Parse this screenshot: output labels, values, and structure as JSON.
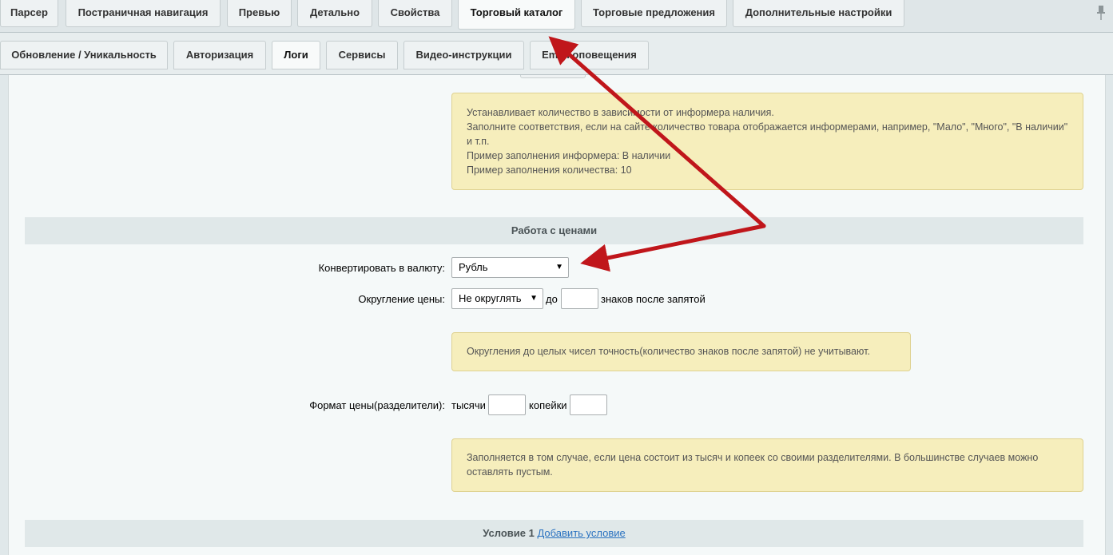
{
  "tabs_top": [
    "Парсер",
    "Постраничная навигация",
    "Превью",
    "Детально",
    "Свойства",
    "Торговый каталог",
    "Торговые предложения",
    "Дополнительные настройки"
  ],
  "tabs_second": [
    "Обновление / Уникальность",
    "Авторизация",
    "Логи",
    "Сервисы",
    "Видео-инструкции",
    "Email оповещения"
  ],
  "info_quantity": {
    "line1": "Устанавливает количество в зависимости от информера наличия.",
    "line2": "Заполните соответствия, если на сайте количество товара отображается информерами, например, \"Мало\", \"Много\", \"В наличии\" и т.п.",
    "line3": "Пример заполнения информера: В наличии",
    "line4": "Пример заполнения количества: 10"
  },
  "section_prices": "Работа с ценами",
  "convert": {
    "label": "Конвертировать в валюту:",
    "value": "Рубль"
  },
  "rounding": {
    "label": "Округление цены:",
    "value": "Не округлять",
    "to": "до",
    "suffix": "знаков после запятой"
  },
  "info_rounding": "Округления до целых чисел точность(количество знаков после запятой) не учитывают.",
  "format": {
    "label": "Формат цены(разделители):",
    "thousands": "тысячи",
    "kopecks": "копейки"
  },
  "info_format": "Заполняется в том случае, если цена состоит из тысяч и копеек со своими разделителями. В большинстве случаев можно оставлять пустым.",
  "condition": {
    "title": "Условие 1",
    "link": "Добавить условие"
  },
  "colors": {
    "annotation_arrow": "#c0161b",
    "note_bg": "#f6eebc",
    "section_bg": "#e0e8e9",
    "link": "#2a72c0"
  }
}
